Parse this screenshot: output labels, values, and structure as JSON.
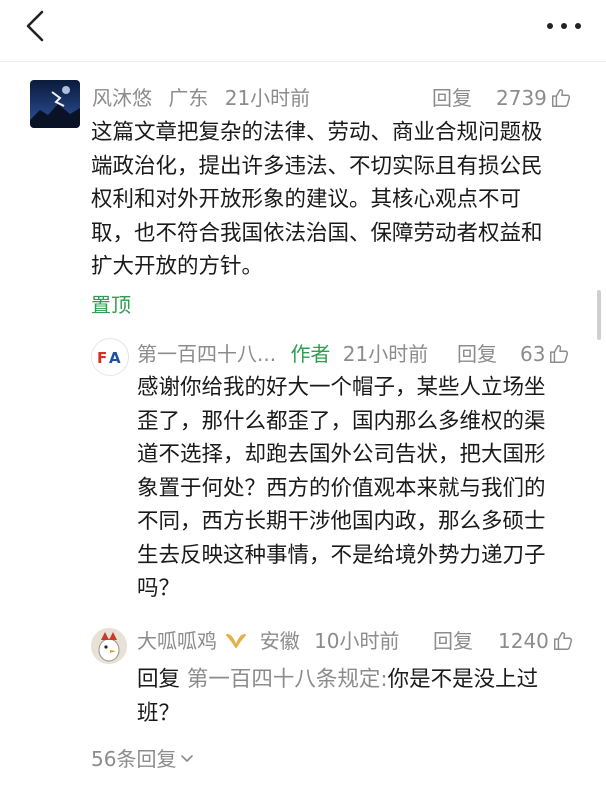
{
  "header": {
    "back_icon": "chevron-left-icon",
    "more_icon": "ellipsis-icon"
  },
  "comment": {
    "username": "风沐悠",
    "location": "广东",
    "time": "21小时前",
    "reply_label": "回复",
    "likes": "2739",
    "text_lines": [
      "这篇文章把复杂的法律、劳动、商业合规问题极",
      "端政治化，提出许多违法、不切实际且有损公民",
      "权利和对外开放形象的建议。其核心观点不可",
      "取，也不符合我国依法治国、保障劳动者权益和",
      "扩大开放的方针。"
    ],
    "pinned_label": "置顶"
  },
  "replies": [
    {
      "username": "第一百四十八...",
      "author_tag": "作者",
      "time": "21小时前",
      "reply_label": "回复",
      "likes": "63",
      "avatar_text": "FA",
      "text_lines": [
        "感谢你给我的好大一个帽子，某些人立场坐",
        "歪了，那什么都歪了，国内那么多维权的渠",
        "道不选择，却跑去国外公司告状，把大国形",
        "象置于何处？西方的价值观本来就与我们的",
        "不同，西方长期干涉他国内政，那么多硕士",
        "生去反映这种事情，不是给境外势力递刀子",
        "吗？"
      ]
    },
    {
      "username": "大呱呱鸡",
      "badge_icon": "gold-ribbon-icon",
      "location": "安徽",
      "time": "10小时前",
      "reply_label": "回复",
      "likes": "1240",
      "reply_prefix": "回复",
      "reply_to": "第一百四十八条规定:",
      "text_first": "你是不是没上过",
      "text_second": "班？"
    }
  ],
  "footer": {
    "more_replies": "56条回复"
  }
}
